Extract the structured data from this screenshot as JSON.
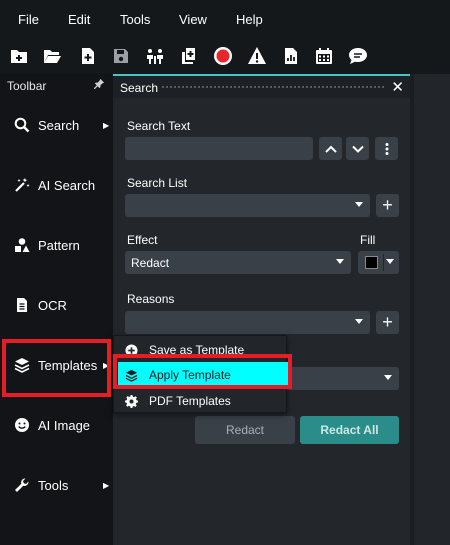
{
  "menubar": {
    "items": [
      "File",
      "Edit",
      "Tools",
      "View",
      "Help"
    ]
  },
  "toolbar_icons": [
    "new-file-icon",
    "open-folder-icon",
    "add-page-icon",
    "save-icon",
    "compare-icon",
    "copy-add-icon",
    "record-icon",
    "warning-icon",
    "report-icon",
    "calendar-icon",
    "comment-icon"
  ],
  "left_panel": {
    "title": "Toolbar",
    "pin": "📌",
    "items": [
      {
        "label": "Search",
        "icon": "search-icon",
        "arrow": "▶"
      },
      {
        "label": "AI Search",
        "icon": "magic-wand-icon",
        "arrow": ""
      },
      {
        "label": "Pattern",
        "icon": "shapes-icon",
        "arrow": ""
      },
      {
        "label": "OCR",
        "icon": "document-icon",
        "arrow": ""
      },
      {
        "label": "Templates",
        "icon": "layers-icon",
        "arrow": "▶"
      },
      {
        "label": "AI Image",
        "icon": "smiley-icon",
        "arrow": ""
      },
      {
        "label": "Tools",
        "icon": "wrench-icon",
        "arrow": "▶"
      }
    ]
  },
  "search_panel": {
    "title": "Search",
    "close": "✕",
    "search_text_label": "Search Text",
    "search_text_value": "",
    "search_list_label": "Search List",
    "search_list_value": "",
    "effect_label": "Effect",
    "effect_value": "Redact",
    "fill_label": "Fill",
    "fill_color": "#000000",
    "reasons_label": "Reasons",
    "reasons_value": "",
    "add_symbol": "+",
    "redact_button": "Redact",
    "redact_all_button": "Redact All"
  },
  "context_menu": {
    "items": [
      {
        "label": "Save as Template",
        "icon": "plus-circle-icon"
      },
      {
        "label": "Apply Template",
        "icon": "layers-icon"
      },
      {
        "label": "PDF Templates",
        "icon": "gear-icon"
      }
    ]
  },
  "colors": {
    "accent": "#47c6c6",
    "highlight": "#00ffff",
    "annotation_red": "#e41e24",
    "redact_all_bg": "#2a8d8a",
    "record_red": "#e8262c"
  }
}
